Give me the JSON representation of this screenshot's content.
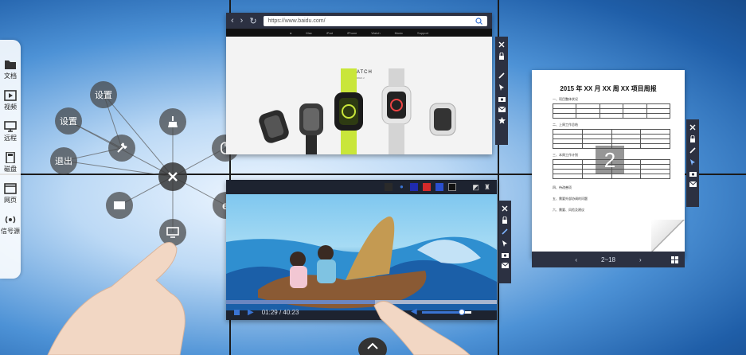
{
  "dock": {
    "items": [
      {
        "icon": "folder-icon",
        "label": "文档"
      },
      {
        "icon": "video-icon",
        "label": "视频"
      },
      {
        "icon": "monitor-icon",
        "label": "远程"
      },
      {
        "icon": "disk-icon",
        "label": "磁盘"
      },
      {
        "icon": "webpage-icon",
        "label": "网页"
      },
      {
        "icon": "signal-icon",
        "label": "信号源"
      }
    ]
  },
  "radial_menu": {
    "settings_top": "设置",
    "settings_left": "设置",
    "exit": "退出"
  },
  "browser": {
    "url": "https://www.baidu.com/",
    "nav_items": [
      "Mac",
      "iPad",
      "iPhone",
      "Watch",
      "Music",
      "Support"
    ],
    "brand": "WATCH",
    "brand_sub": "SERIES 2"
  },
  "video": {
    "current_time": "01:29",
    "total_time": "40:23",
    "progress": 0.55,
    "volume": 0.8,
    "colors": [
      "#1f2bb0",
      "#d32a2a",
      "#2a4fcf",
      "#111111"
    ]
  },
  "doc": {
    "title": "2015 年 XX 月 XX 周 XX 项目周报",
    "sections": [
      "一、项目整体状况",
      "二、上周工作总结",
      "三、本周工作计划",
      "四、待改善项",
      "五、需要外部协调的问题",
      "六、需要、风险及建议"
    ],
    "current_page": "2",
    "page_range": "2~18"
  }
}
